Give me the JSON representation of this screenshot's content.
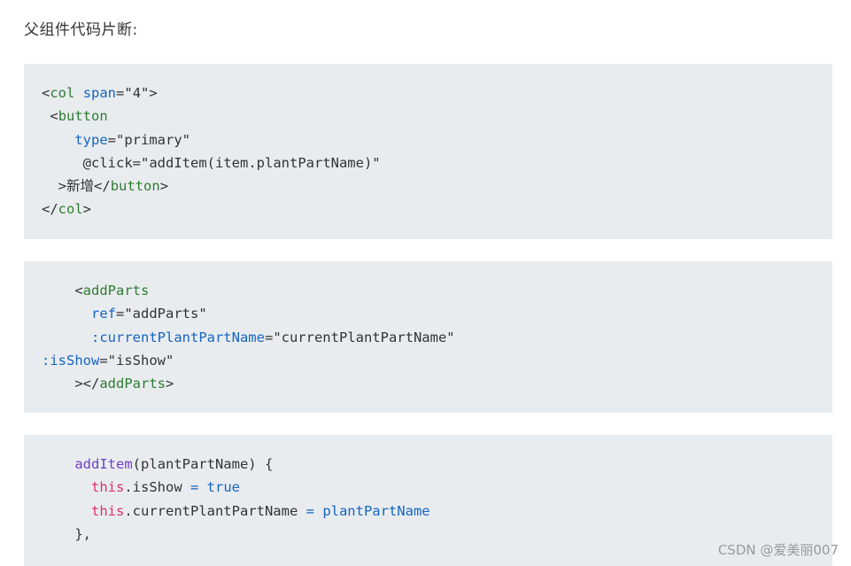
{
  "heading": "父组件代码片断:",
  "block1": {
    "l1": {
      "lt": "<",
      "tag": "col",
      "sp": " ",
      "attr": "span",
      "eq": "=",
      "val": "\"4\"",
      "gt": ">"
    },
    "l2": {
      "lt": "<",
      "tag": "button"
    },
    "l3": {
      "attr": "type",
      "eq": "=",
      "val": "\"primary\""
    },
    "l4": {
      "attr": "@click",
      "eq": "=",
      "val": "\"addItem(item.plantPartName)\""
    },
    "l5": {
      "gt": ">",
      "text": "新增",
      "lt": "</",
      "tag": "button",
      "gt2": ">"
    },
    "l6": {
      "lt": "</",
      "tag": "col",
      "gt": ">"
    }
  },
  "block2": {
    "l1": {
      "lt": "<",
      "tag": "addParts"
    },
    "l2": {
      "attr": "ref",
      "eq": "=",
      "val": "\"addParts\""
    },
    "l3": {
      "attr": ":currentPlantPartName",
      "eq": "=",
      "val": "\"currentPlantPartName\""
    },
    "l4": {
      "attr": ":isShow",
      "eq": "=",
      "val": "\"isShow\""
    },
    "l5": {
      "gt": "></",
      "tag": "addParts",
      "gt2": ">"
    }
  },
  "block3": {
    "l1": {
      "fn": "addItem",
      "rest": "(plantPartName) {"
    },
    "l2": {
      "kw": "this",
      "prop": ".isShow ",
      "op": "=",
      "val": " true"
    },
    "l3": {
      "kw": "this",
      "prop": ".currentPlantPartName ",
      "op": "=",
      "val": " plantPartName"
    },
    "l4": {
      "text": "},"
    }
  },
  "watermark": "CSDN @爱美丽007",
  "colors": {
    "code_background": "#e9ecef",
    "tag": "#2e7d32",
    "attribute": "#1565c0",
    "function": "#6f42c1",
    "keyword": "#d6336c"
  }
}
